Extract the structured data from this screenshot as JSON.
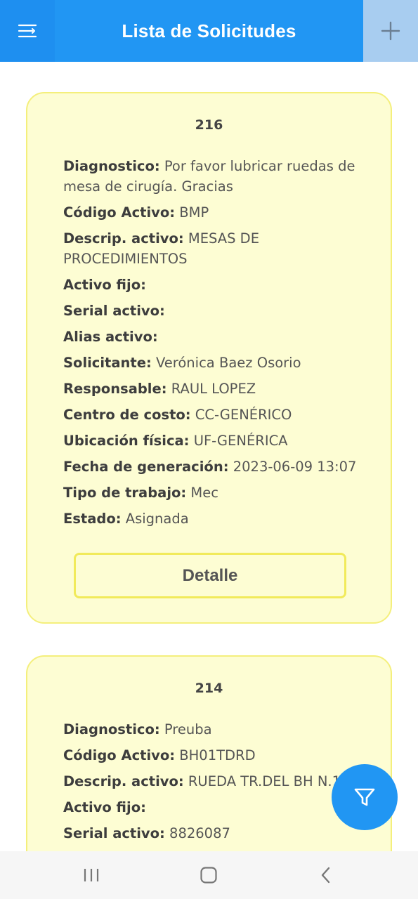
{
  "header": {
    "title": "Lista de Solicitudes",
    "menu_icon": "menu-icon",
    "add_icon": "plus-icon",
    "color": "#2196f3"
  },
  "cards": [
    {
      "id": "216",
      "fields": [
        {
          "label": "Diagnostico:",
          "value": "Por favor lubricar ruedas de mesa de cirugía. Gracias"
        },
        {
          "label": "Código Activo:",
          "value": "BMP"
        },
        {
          "label": "Descrip. activo:",
          "value": "MESAS DE PROCEDIMIENTOS"
        },
        {
          "label": "Activo fijo:",
          "value": ""
        },
        {
          "label": "Serial activo:",
          "value": ""
        },
        {
          "label": "Alias activo:",
          "value": ""
        },
        {
          "label": "Solicitante:",
          "value": "Verónica Baez Osorio"
        },
        {
          "label": "Responsable:",
          "value": "RAUL LOPEZ"
        },
        {
          "label": "Centro de costo:",
          "value": "CC-GENÉRICO"
        },
        {
          "label": "Ubicación física:",
          "value": "UF-GENÉRICA"
        },
        {
          "label": "Fecha de generación:",
          "value": "2023-06-09 13:07"
        },
        {
          "label": "Tipo de trabajo:",
          "value": "Mec"
        },
        {
          "label": "Estado:",
          "value": "Asignada"
        }
      ],
      "button_label": "Detalle"
    },
    {
      "id": "214",
      "fields": [
        {
          "label": "Diagnostico:",
          "value": "Preuba"
        },
        {
          "label": "Código Activo:",
          "value": "BH01TDRD"
        },
        {
          "label": "Descrip. activo:",
          "value": "RUEDA TR.DEL BH N.1"
        },
        {
          "label": "Activo fijo:",
          "value": ""
        },
        {
          "label": "Serial activo:",
          "value": "8826087"
        }
      ]
    }
  ],
  "fab": {
    "icon": "filter-icon"
  },
  "navbar": {
    "recent_icon": "recent-apps-icon",
    "home_icon": "home-icon",
    "back_icon": "back-icon"
  },
  "colors": {
    "card_bg": "#fdfdd3",
    "card_border": "#f4ef7c",
    "accent": "#2196f3"
  }
}
